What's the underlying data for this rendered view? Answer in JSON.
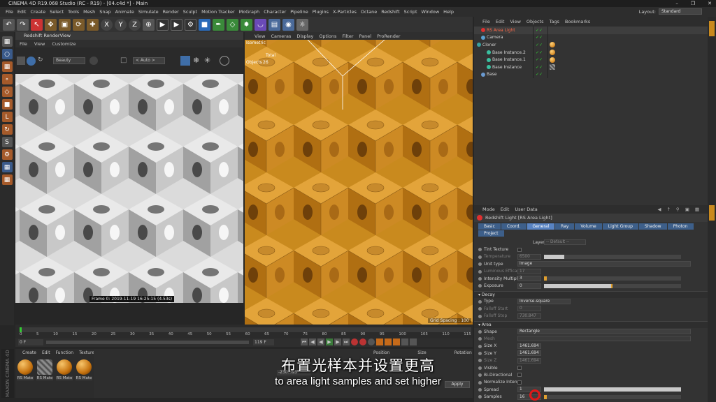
{
  "window": {
    "title": "CINEMA 4D R19.068 Studio (RC - R19) - [04.c4d *] - Main"
  },
  "menubar": {
    "items": [
      "File",
      "Edit",
      "Create",
      "Select",
      "Tools",
      "Mesh",
      "Snap",
      "Animate",
      "Simulate",
      "Render",
      "Sculpt",
      "Motion Tracker",
      "MoGraph",
      "Character",
      "Pipeline",
      "Plugins",
      "X-Particles",
      "Octane",
      "Redshift",
      "Script",
      "Window",
      "Help"
    ],
    "layout_label": "Layout:",
    "layout_value": "Standard"
  },
  "render_view": {
    "title": "Redshift RenderView",
    "menu": [
      "File",
      "View",
      "Customize"
    ],
    "aov_value": "Beauty",
    "auto_value": "< Auto >",
    "frame_label": "Frame 0: 2019-11-19 16:25:15 (4.53s)"
  },
  "viewport": {
    "menu": [
      "View",
      "Cameras",
      "Display",
      "Options",
      "Filter",
      "Panel",
      "ProRender"
    ],
    "camera_label": "Isometric",
    "total_label": "Total",
    "objects_label": "Objects",
    "objects_count": "26",
    "grid_spacing": "Grid Spacing : 100"
  },
  "timeline": {
    "ticks": [
      "0",
      "5",
      "10",
      "15",
      "20",
      "25",
      "30",
      "35",
      "40",
      "45",
      "50",
      "55",
      "60",
      "65",
      "70",
      "75",
      "80",
      "85",
      "90",
      "95",
      "100",
      "105",
      "110",
      "115"
    ],
    "current_frame": "0 F",
    "start_frame": "0 F",
    "end_frame": "119 F",
    "max_frame": "119 F"
  },
  "material_manager": {
    "menu": [
      "Create",
      "Edit",
      "Function",
      "Texture"
    ],
    "materials": [
      "RS Mate",
      "RS Mate",
      "RS Mate",
      "RS Mate"
    ]
  },
  "coordinates": {
    "headers": [
      "Position",
      "Size",
      "Rotation"
    ],
    "position_x": "-230.393",
    "apply_label": "Apply"
  },
  "object_manager": {
    "menu": [
      "File",
      "Edit",
      "View",
      "Objects",
      "Tags",
      "Bookmarks"
    ],
    "objects": [
      {
        "name": "RS Area Light",
        "selected": true
      },
      {
        "name": "Camera",
        "selected": false
      },
      {
        "name": "Cloner",
        "selected": false
      },
      {
        "name": "Base Instance.2",
        "selected": false
      },
      {
        "name": "Base Instance.1",
        "selected": false
      },
      {
        "name": "Base Instance",
        "selected": false
      },
      {
        "name": "Base",
        "selected": false
      }
    ]
  },
  "attributes": {
    "menu": [
      "Mode",
      "Edit",
      "User Data"
    ],
    "title": "Redshift Light [RS Area Light]",
    "tabs": [
      "Basic",
      "Coord.",
      "General",
      "Ray",
      "Volume",
      "Light Group",
      "Shadow",
      "Photon",
      "Project"
    ],
    "active_tab": "General",
    "layer_label": "Layer",
    "layer_value": "-- Default --",
    "general_rows": [
      {
        "label": "Tint Texture",
        "value": "",
        "type": "check"
      },
      {
        "label": "Temperature",
        "value": "6500",
        "type": "slider",
        "dim": true,
        "level": 0.15
      },
      {
        "label": "Unit type",
        "value": "Image",
        "type": "select"
      },
      {
        "label": "Luminous Efficacy (lm/w)",
        "value": "17",
        "type": "field",
        "dim": true
      },
      {
        "label": "Intensity Multiplier",
        "value": "3",
        "type": "slider",
        "level": 0.02
      },
      {
        "label": "Exposure",
        "value": "0",
        "type": "slider",
        "level": 0.5
      }
    ],
    "decay_section": "Decay",
    "decay_rows": [
      {
        "label": "Type",
        "value": "Inverse-square",
        "type": "select"
      },
      {
        "label": "Falloff Start",
        "value": "0",
        "type": "field",
        "dim": true
      },
      {
        "label": "Falloff Stop",
        "value": "730.847",
        "type": "field",
        "dim": true
      }
    ],
    "area_section": "Area",
    "area_rows": [
      {
        "label": "Shape",
        "value": "Rectangle",
        "type": "select"
      },
      {
        "label": "Mesh",
        "value": "",
        "type": "field",
        "dim": true
      },
      {
        "label": "Size X",
        "value": "1461.694",
        "type": "field"
      },
      {
        "label": "Size Y",
        "value": "1461.694",
        "type": "field"
      },
      {
        "label": "Size Z",
        "value": "1461.694",
        "type": "field",
        "dim": true
      },
      {
        "label": "Visible",
        "value": "",
        "type": "check"
      },
      {
        "label": "Bi-Directional",
        "value": "",
        "type": "check"
      },
      {
        "label": "Normalize Intensity",
        "value": "",
        "type": "check"
      },
      {
        "label": "Spread",
        "value": "1",
        "type": "slider",
        "level": 1.0
      },
      {
        "label": "Samples",
        "value": "16",
        "type": "slider",
        "level": 0.02
      }
    ]
  },
  "subtitles": {
    "cn": "布置光样本并设置更高",
    "en": "to area light samples and set higher"
  },
  "branding": {
    "maxon": "MAXON CINEMA 4D"
  }
}
